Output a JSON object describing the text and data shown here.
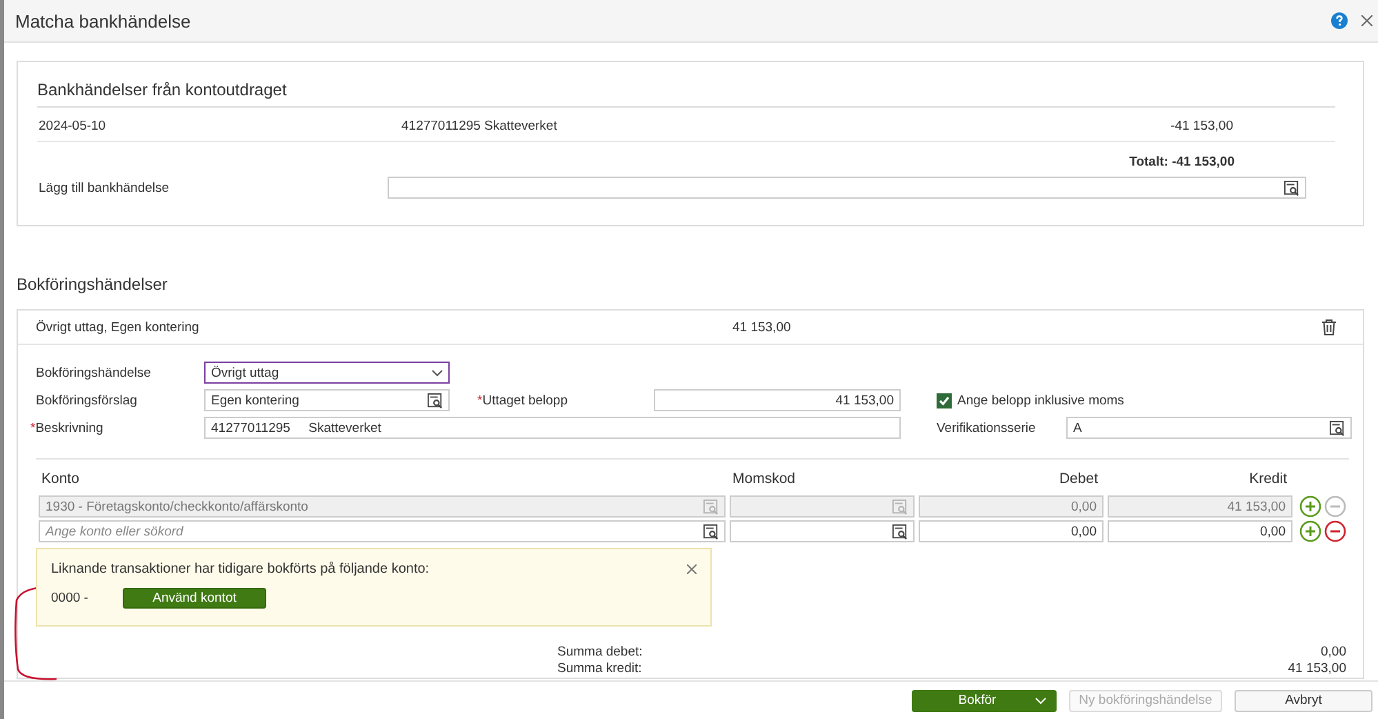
{
  "window": {
    "title": "Matcha bankhändelse"
  },
  "bank_transactions": {
    "title": "Bankhändelser från kontoutdraget",
    "rows": [
      {
        "date": "2024-05-10",
        "reference": "41277011295 Skatteverket",
        "amount": "-41 153,00"
      }
    ],
    "total": "Totalt: -41 153,00",
    "add_label": "Lägg till bankhändelse"
  },
  "booking": {
    "title": "Bokföringshändelser",
    "header": {
      "summary": "Övrigt uttag, Egen kontering",
      "amount": "41 153,00"
    },
    "event_type": {
      "label": "Bokföringshändelse",
      "value": "Övrigt uttag",
      "focused": true
    },
    "proposal": {
      "label": "Bokföringsförslag",
      "value": "Egen kontering"
    },
    "amount": {
      "required_mark": "*",
      "label": "Uttaget belopp",
      "value": "41 153,00"
    },
    "include_vat": {
      "label": "Ange belopp inklusive moms",
      "checked": true
    },
    "description": {
      "required_mark": "*",
      "label": "Beskrivning",
      "value": "41277011295     Skatteverket"
    },
    "series": {
      "label": "Verifikationsserie",
      "value": "A"
    },
    "lines": {
      "columns": [
        "Konto",
        "Momskod",
        "Debet",
        "Kredit"
      ],
      "rows": [
        {
          "account": "1930 - Företagskonto/checkkonto/affärskonto",
          "debit": "0,00",
          "credit": "41 153,00",
          "disabled": true
        },
        {
          "account_placeholder": "Ange konto eller sökord",
          "debit": "0,00",
          "credit": "0,00",
          "disabled": false
        }
      ]
    },
    "notice": {
      "text": "Liknande transaktioner har tidigare bokförts på följande konto:",
      "account": "0000 -",
      "button": "Använd kontot"
    },
    "totals": [
      {
        "label": "Summa debet:",
        "value": "0,00"
      },
      {
        "label": "Summa kredit:",
        "value": "41 153,00"
      }
    ]
  },
  "footer": {
    "buttons": [
      {
        "label": "Bokför",
        "kind": "primary"
      },
      {
        "label": "Ny bokföringshändelse",
        "kind": "disabled"
      },
      {
        "label": "Avbryt",
        "kind": "default"
      }
    ]
  }
}
